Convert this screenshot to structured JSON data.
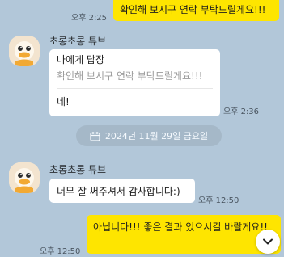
{
  "colors": {
    "background": "#b2c7d9",
    "my_bubble": "#fee500",
    "their_bubble": "#ffffff",
    "date_pill": "#a5b8c8"
  },
  "messages": {
    "top_outgoing": {
      "time": "오후 2:25",
      "text": "확인해 보시구 연락 부탁드릴게요!!!"
    },
    "group1": {
      "sender": "초롱초롱 튜브",
      "reply_header": "나에게 답장",
      "reply_quote": "확인해 보시구 연락 부탁드릴게요!!!",
      "text": "네!",
      "time": "오후 2:36"
    },
    "date_separator": {
      "icon": "calendar-icon",
      "text": "2024년 11월 29일 금요일"
    },
    "group2": {
      "sender": "초롱초롱 튜브",
      "text": "너무 잘 써주셔서 감사합니다:)",
      "time": "오후 12:50"
    },
    "bottom_outgoing": {
      "time": "오후 12:50",
      "text": "아닙니다!!! 좋은 결과 있으시길 바랄게요!!"
    }
  },
  "scroll_button": {
    "icon": "chevron-down-icon"
  }
}
